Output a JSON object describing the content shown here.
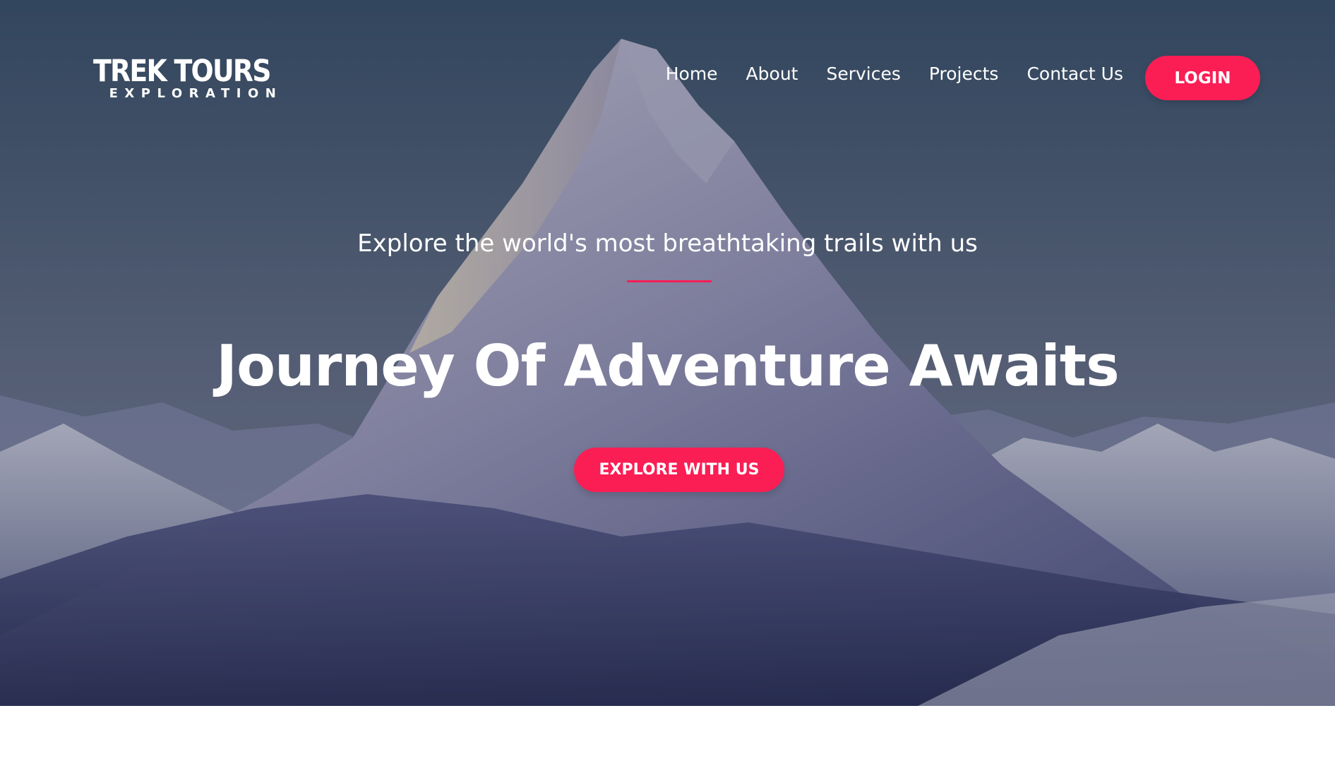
{
  "brand": {
    "name": "TREK TOURS",
    "tagline": "EXPLORATION"
  },
  "nav": {
    "items": [
      {
        "label": "Home"
      },
      {
        "label": "About"
      },
      {
        "label": "Services"
      },
      {
        "label": "Projects"
      },
      {
        "label": "Contact Us"
      }
    ],
    "login_label": "LOGIN"
  },
  "hero": {
    "subtitle": "Explore the world's most breathtaking trails with us",
    "title": "Journey Of Adventure Awaits",
    "cta_label": "EXPLORE WITH US",
    "background_icon": "mountain-landscape-image"
  },
  "colors": {
    "accent": "#fa1e55",
    "text": "#ffffff"
  }
}
